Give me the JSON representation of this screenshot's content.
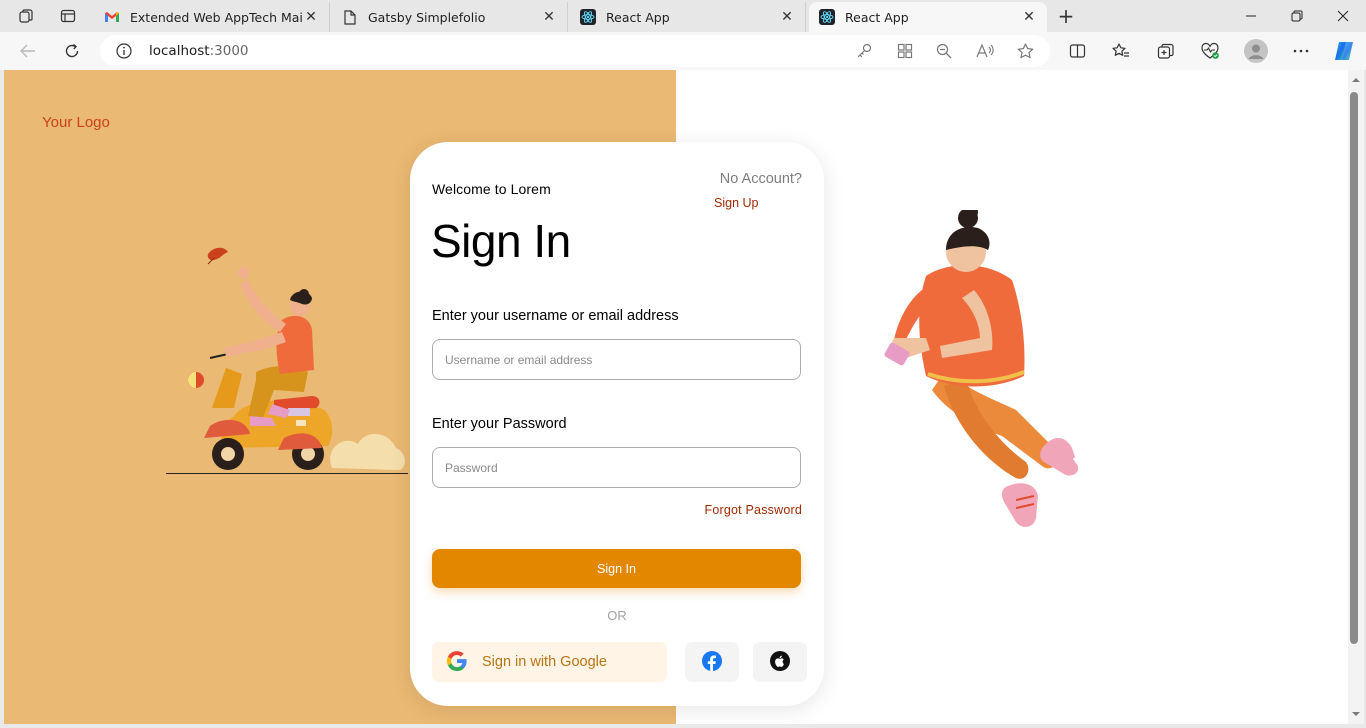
{
  "browser": {
    "tabs": [
      {
        "title": "Extended Web AppTech Mail",
        "icon": "gmail-icon",
        "active": false
      },
      {
        "title": "Gatsby Simplefolio",
        "icon": "page-icon",
        "active": false
      },
      {
        "title": "React App",
        "icon": "react-icon",
        "active": false
      },
      {
        "title": "React App",
        "icon": "react-icon",
        "active": true
      }
    ],
    "url_host": "localhost",
    "url_port": ":3000"
  },
  "page": {
    "logo": "Your Logo",
    "welcome": "Welcome to Lorem",
    "no_account": "No Account?",
    "signup_link": "Sign Up",
    "title": "Sign In",
    "username_label": "Enter your username or email address",
    "username_placeholder": "Username or email address",
    "password_label": "Enter your Password",
    "password_placeholder": "Password",
    "forgot": "Forgot Password",
    "signin_button": "Sign In",
    "or": "OR",
    "google_button": "Sign in with Google"
  },
  "colors": {
    "left_panel": "#eab973",
    "primary_button": "#e48700",
    "link": "#a02a00",
    "logo": "#c9421c",
    "google_button_bg": "#fff4e5"
  }
}
